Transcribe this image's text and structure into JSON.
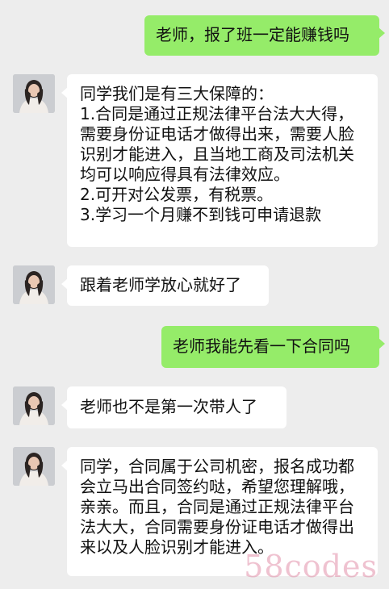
{
  "messages": [
    {
      "side": "right",
      "text": "老师，报了班一定能赚钱吗"
    },
    {
      "side": "left",
      "text": "同学我们是有三大保障的：\n1.合同是通过正规法律平台法大大得，需要身份证电话才做得出来，需要人脸识别才能进入，且当地工商及司法机关均可以响应得具有法律效应。\n2.可开对公发票，有税票。\n3.学习一个月赚不到钱可申请退款"
    },
    {
      "side": "left",
      "text": "跟着老师学放心就好了"
    },
    {
      "side": "right",
      "text": "老师我能先看一下合同吗"
    },
    {
      "side": "left",
      "text": "老师也不是第一次带人了"
    },
    {
      "side": "left",
      "text": "同学，合同属于公司机密，报名成功都会立马出合同签约哒，希望您理解哦，亲亲。而且，合同是通过正规法律平台法大大，合同需要身份证电话才做得出来以及人脸识别才能进入。"
    }
  ],
  "watermark": "58codes",
  "colors": {
    "background": "#ededed",
    "sent_bubble": "#95ec69",
    "received_bubble": "#ffffff"
  }
}
